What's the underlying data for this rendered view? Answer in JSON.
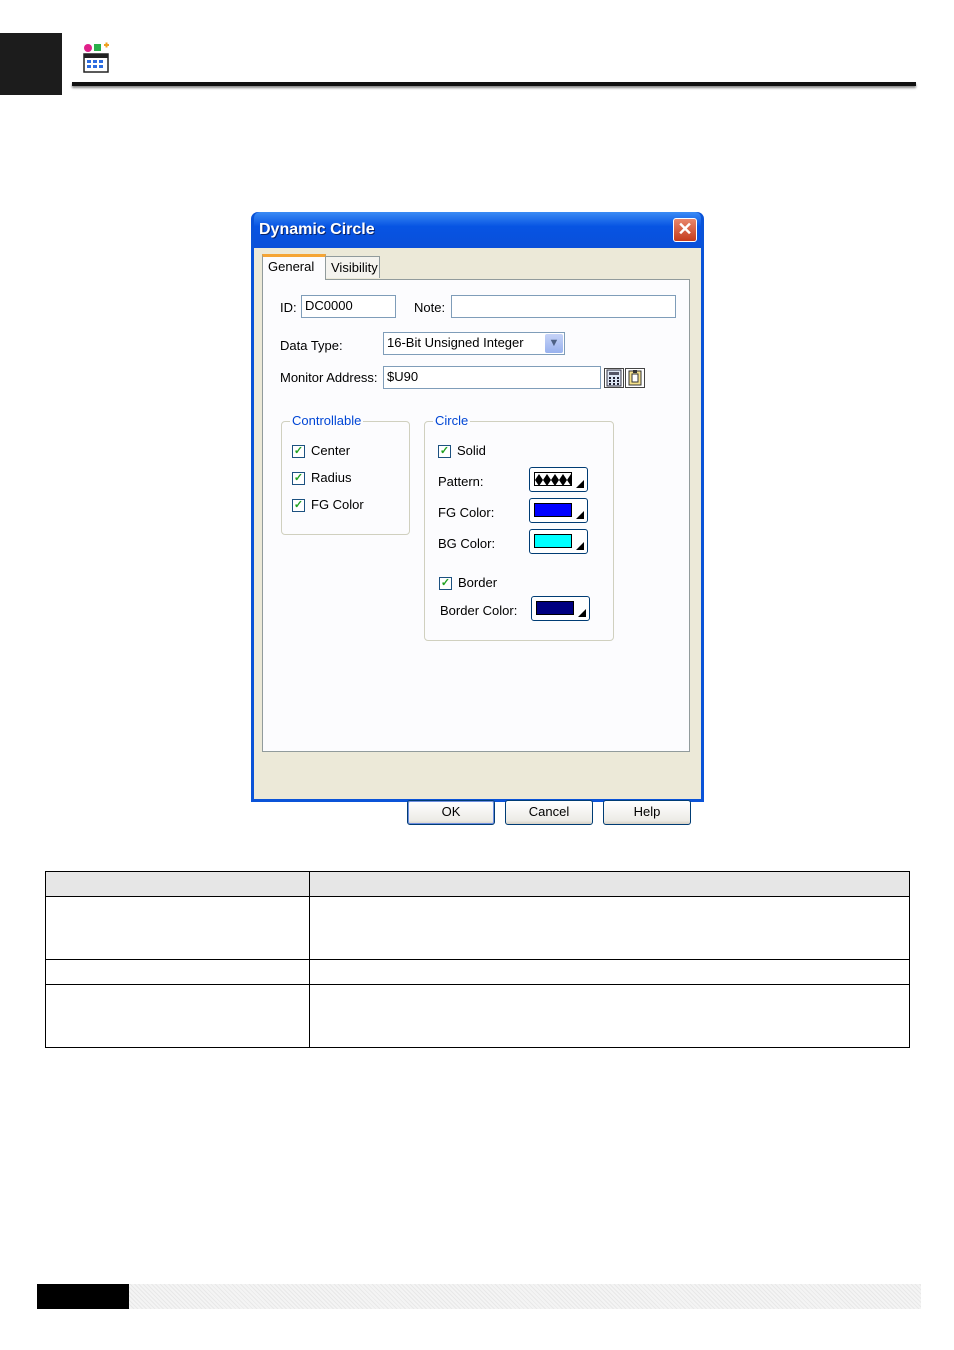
{
  "dialog": {
    "title": "Dynamic Circle",
    "close_glyph": "✕",
    "tabs": [
      {
        "label": "General"
      },
      {
        "label": "Visibility"
      }
    ],
    "general": {
      "id_label": "ID:",
      "id_value": "DC0000",
      "note_label": "Note:",
      "note_value": "",
      "data_type_label": "Data Type:",
      "data_type_value": "16-Bit Unsigned Integer",
      "monitor_address_label": "Monitor Address:",
      "monitor_address_value": "$U90"
    },
    "controllable": {
      "title": "Controllable",
      "items": [
        {
          "label": "Center",
          "checked": true
        },
        {
          "label": "Radius",
          "checked": true
        },
        {
          "label": "FG Color",
          "checked": true
        }
      ]
    },
    "circle": {
      "title": "Circle",
      "solid_label": "Solid",
      "solid_checked": true,
      "pattern_label": "Pattern:",
      "fg_color_label": "FG Color:",
      "fg_color": "#0000ff",
      "bg_color_label": "BG Color:",
      "bg_color": "#00ffff",
      "border_label": "Border",
      "border_checked": true,
      "border_color_label": "Border Color:",
      "border_color": "#000080"
    },
    "buttons": {
      "ok": "OK",
      "cancel": "Cancel",
      "help": "Help"
    }
  },
  "colors": {
    "title_bar": "#0a53d8",
    "dialog_bg": "#ece9d8",
    "group_title": "#0046d5"
  },
  "table": {
    "rows": 4,
    "columns": 2
  }
}
